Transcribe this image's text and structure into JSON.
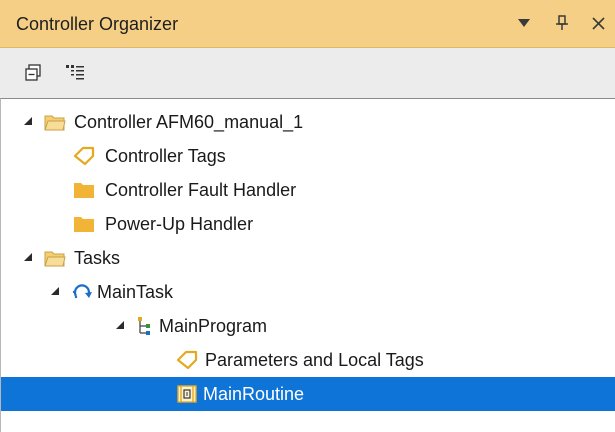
{
  "window": {
    "title": "Controller Organizer",
    "controls": {
      "dropdown": "▼",
      "pin": "⊥",
      "close": "✕"
    }
  },
  "toolbar": {
    "buttons": [
      "collapse-all-icon",
      "property-list-icon"
    ]
  },
  "tree": {
    "selected_item": "MainRoutine",
    "colors": {
      "selection": "#0f74d7",
      "folder": "#f2b437",
      "tag": "#e5a91f"
    },
    "items": [
      {
        "label": "Controller AFM60_manual_1",
        "icon": "open-folder-icon"
      },
      {
        "label": "Controller Tags",
        "icon": "tag-icon"
      },
      {
        "label": "Controller Fault Handler",
        "icon": "folder-icon"
      },
      {
        "label": "Power-Up Handler",
        "icon": "folder-icon"
      },
      {
        "label": "Tasks",
        "icon": "open-folder-icon"
      },
      {
        "label": "MainTask",
        "icon": "task-cycle-icon"
      },
      {
        "label": "MainProgram",
        "icon": "program-icon"
      },
      {
        "label": "Parameters and Local Tags",
        "icon": "tag-icon"
      },
      {
        "label": "MainRoutine",
        "icon": "routine-icon"
      }
    ]
  }
}
